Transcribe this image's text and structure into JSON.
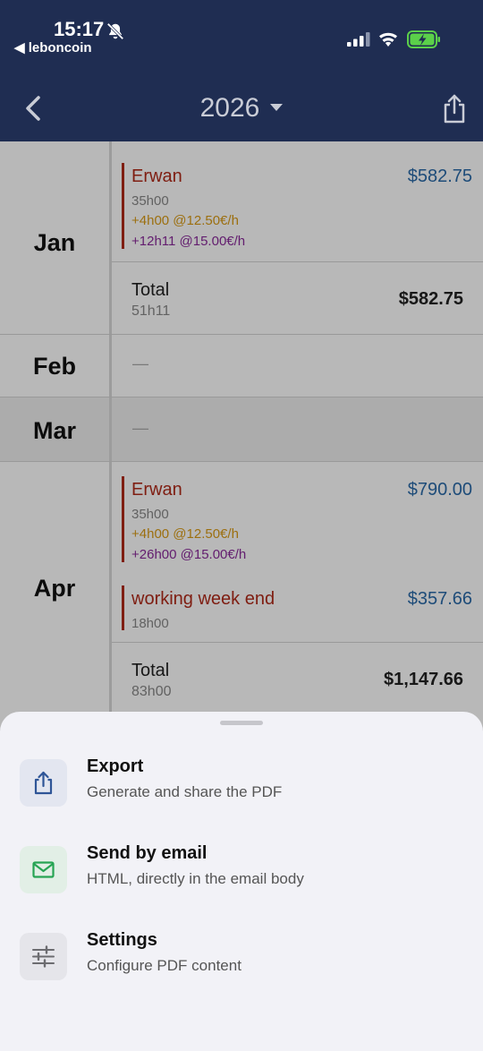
{
  "status_bar": {
    "time": "15:17",
    "back_app": "◀ leboncoin",
    "icons": [
      "bell-slash-icon",
      "cellular-signal-icon",
      "wifi-icon",
      "battery-charging-icon"
    ],
    "battery_color": "#5bd04a"
  },
  "nav": {
    "year": "2026",
    "back_icon": "chevron-left-icon",
    "share_icon": "share-icon"
  },
  "months": [
    {
      "label": "Jan",
      "entries": [
        {
          "name": "Erwan",
          "amount": "$582.75",
          "hours": "35h00",
          "line1": "+4h00 @12.50€/h",
          "line2": "+12h11 @15.00€/h"
        }
      ],
      "total": {
        "label": "Total",
        "hours": "51h11",
        "amount": "$582.75"
      }
    },
    {
      "label": "Feb",
      "empty": "—"
    },
    {
      "label": "Mar",
      "empty": "—"
    },
    {
      "label": "Apr",
      "entries": [
        {
          "name": "Erwan",
          "amount": "$790.00",
          "hours": "35h00",
          "line1": "+4h00 @12.50€/h",
          "line2": "+26h00 @15.00€/h"
        },
        {
          "name": "working week  end",
          "amount": "$357.66",
          "hours": "18h00"
        }
      ],
      "total": {
        "label": "Total",
        "hours": "83h00",
        "amount": "$1,147.66"
      }
    }
  ],
  "sheet": {
    "options": [
      {
        "title": "Export",
        "subtitle": "Generate and share the PDF",
        "icon": "share-icon",
        "color": "#2f5597"
      },
      {
        "title": "Send by email",
        "subtitle": "HTML, directly in the email body",
        "icon": "mail-icon",
        "color": "#27a454"
      },
      {
        "title": "Settings",
        "subtitle": "Configure PDF content",
        "icon": "sliders-icon",
        "color": "#6c6c70"
      }
    ]
  },
  "colors": {
    "nav_bg": "#1f2d52",
    "employee_name": "#b02a1a",
    "amount": "#2a6aa8",
    "rate_1": "#d99a15",
    "rate_2": "#8a2a9a"
  }
}
